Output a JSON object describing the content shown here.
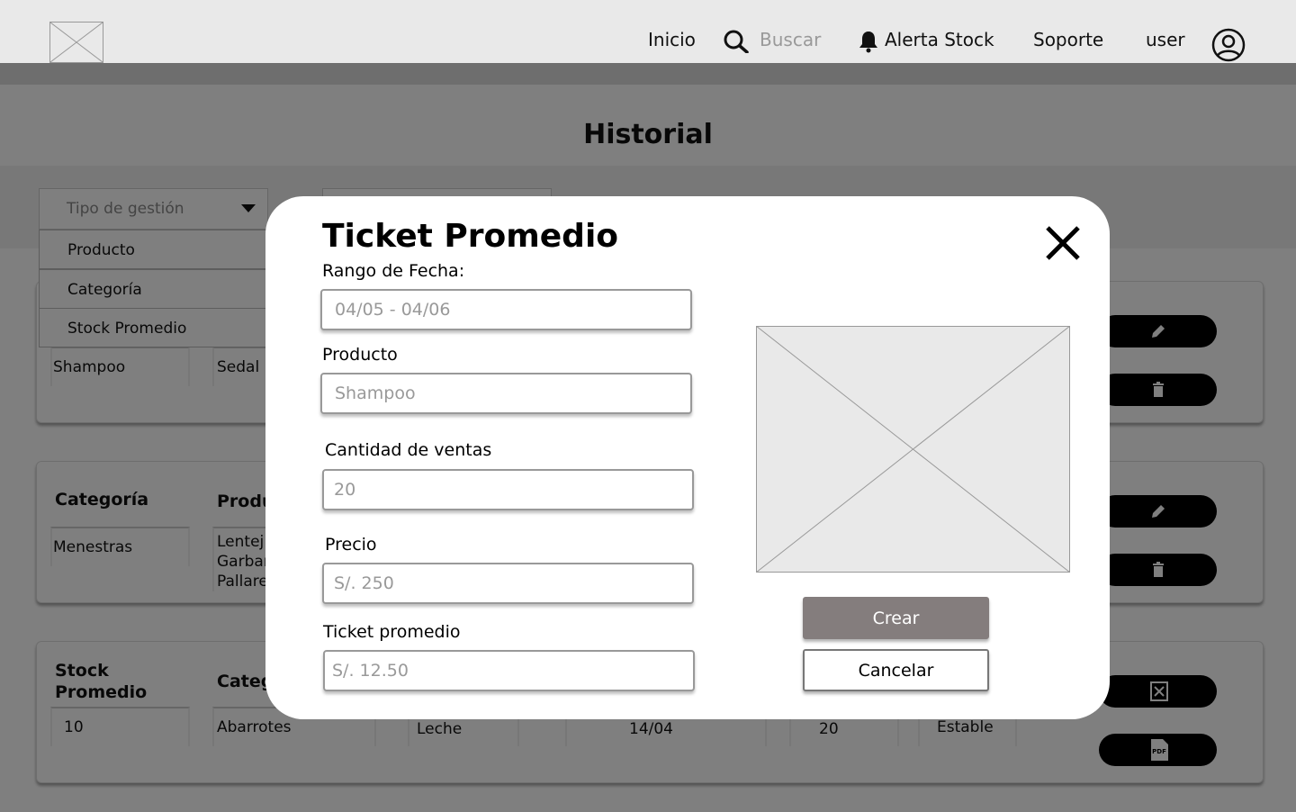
{
  "header": {
    "nav": {
      "inicio": "Inicio",
      "search_placeholder": "Buscar",
      "alerta": "Alerta Stock",
      "soporte": "Soporte",
      "user": "user"
    }
  },
  "page": {
    "title": "Historial",
    "filter": {
      "placeholder": "Tipo de gestión",
      "options": [
        "Producto",
        "Categoría",
        "Stock Promedio"
      ]
    },
    "cards": [
      {
        "cells": [
          "Shampoo",
          "Sedal"
        ]
      },
      {
        "labels": [
          "Categoría",
          "Produ"
        ],
        "cells": [
          "Menestras"
        ],
        "list": [
          "Lentej",
          "Garbar",
          "Pallare"
        ]
      },
      {
        "labels": [
          "Stock\nPromedio",
          "Categ"
        ],
        "cells": [
          "10",
          "Abarrotes",
          "Leche",
          "14/04",
          "20",
          "Estable"
        ]
      }
    ]
  },
  "modal": {
    "title": "Ticket Promedio",
    "fields": {
      "rango": {
        "label": "Rango de Fecha:",
        "placeholder": "04/05 - 04/06"
      },
      "producto": {
        "label": "Producto",
        "placeholder": "Shampoo"
      },
      "cantidad": {
        "label": "Cantidad de ventas",
        "placeholder": "20"
      },
      "precio": {
        "label": "Precio",
        "placeholder": "S/. 250"
      },
      "ticket": {
        "label": "Ticket promedio",
        "placeholder": "S/. 12.50"
      }
    },
    "buttons": {
      "create": "Crear",
      "cancel": "Cancelar"
    }
  }
}
